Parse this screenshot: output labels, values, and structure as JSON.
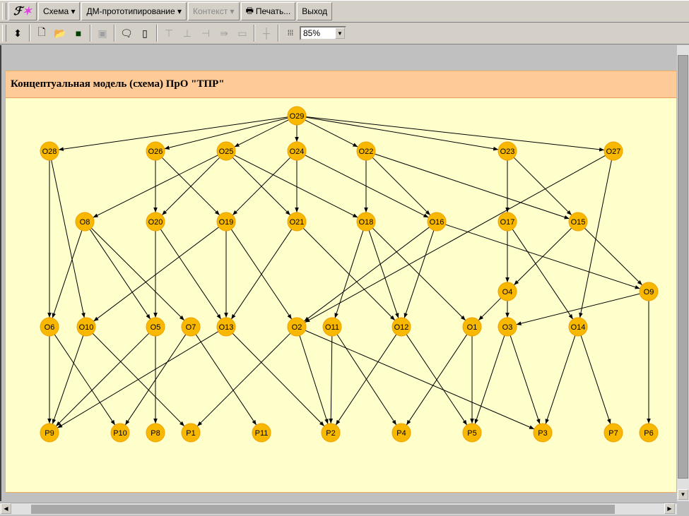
{
  "menubar": {
    "app_icon": "palette-icon",
    "schema": "Схема ▾",
    "prototyping": "ДМ-прототипирование ▾",
    "context": "Контекст ▾",
    "print": "Печать...",
    "print_icon": "printer-icon",
    "exit": "Выход"
  },
  "toolbar": {
    "zoom_value": "85%",
    "icons": [
      "move-updown-icon",
      "new-document-icon",
      "open-folder-icon",
      "save-icon",
      "clipboard-icon",
      "comment-icon",
      "scroll-icon",
      "align-top-icon",
      "align-bottom-icon",
      "align-left-icon",
      "align-right-icon",
      "frame-icon",
      "crosshair-icon",
      "grid-icon"
    ]
  },
  "panel": {
    "title": "Концептуальная модель (схема) ПрО  \"ТПР\""
  },
  "graph": {
    "colors": {
      "node_fill": "#f8b800",
      "node_stroke": "#f0a000",
      "edge": "#000000"
    },
    "nodes": [
      "O29",
      "O28",
      "O26",
      "O25",
      "O24",
      "O22",
      "O23",
      "O27",
      "O8",
      "O20",
      "O19",
      "O21",
      "O18",
      "O16",
      "O17",
      "O15",
      "O4",
      "O9",
      "O6",
      "O10",
      "O5",
      "O7",
      "O13",
      "O2",
      "O11",
      "O12",
      "O1",
      "O3",
      "O14",
      "P9",
      "P10",
      "P8",
      "P1",
      "P11",
      "P2",
      "P4",
      "P5",
      "P3",
      "P7",
      "P6"
    ],
    "edges": [
      [
        "O29",
        "O28"
      ],
      [
        "O29",
        "O26"
      ],
      [
        "O29",
        "O25"
      ],
      [
        "O29",
        "O24"
      ],
      [
        "O29",
        "O22"
      ],
      [
        "O29",
        "O23"
      ],
      [
        "O29",
        "O27"
      ],
      [
        "O28",
        "O6"
      ],
      [
        "O28",
        "O10"
      ],
      [
        "O26",
        "O20"
      ],
      [
        "O26",
        "O19"
      ],
      [
        "O25",
        "O8"
      ],
      [
        "O25",
        "O20"
      ],
      [
        "O25",
        "O21"
      ],
      [
        "O25",
        "O18"
      ],
      [
        "O24",
        "O19"
      ],
      [
        "O24",
        "O21"
      ],
      [
        "O24",
        "O16"
      ],
      [
        "O22",
        "O18"
      ],
      [
        "O22",
        "O16"
      ],
      [
        "O22",
        "O15"
      ],
      [
        "O23",
        "O17"
      ],
      [
        "O23",
        "O15"
      ],
      [
        "O27",
        "O2"
      ],
      [
        "O27",
        "O14"
      ],
      [
        "O8",
        "O6"
      ],
      [
        "O8",
        "O5"
      ],
      [
        "O8",
        "O7"
      ],
      [
        "O20",
        "O5"
      ],
      [
        "O20",
        "O13"
      ],
      [
        "O19",
        "O10"
      ],
      [
        "O19",
        "O13"
      ],
      [
        "O19",
        "O2"
      ],
      [
        "O21",
        "O13"
      ],
      [
        "O21",
        "O12"
      ],
      [
        "O18",
        "O11"
      ],
      [
        "O18",
        "O12"
      ],
      [
        "O18",
        "O1"
      ],
      [
        "O16",
        "O2"
      ],
      [
        "O16",
        "O12"
      ],
      [
        "O16",
        "O9"
      ],
      [
        "O17",
        "O4"
      ],
      [
        "O17",
        "O14"
      ],
      [
        "O15",
        "O4"
      ],
      [
        "O15",
        "O9"
      ],
      [
        "O4",
        "O1"
      ],
      [
        "O4",
        "O3"
      ],
      [
        "O9",
        "O3"
      ],
      [
        "O9",
        "P6"
      ],
      [
        "O6",
        "P9"
      ],
      [
        "O6",
        "P10"
      ],
      [
        "O10",
        "P9"
      ],
      [
        "O10",
        "P1"
      ],
      [
        "O5",
        "P9"
      ],
      [
        "O5",
        "P8"
      ],
      [
        "O7",
        "P10"
      ],
      [
        "O7",
        "P11"
      ],
      [
        "O13",
        "P9"
      ],
      [
        "O13",
        "P2"
      ],
      [
        "O2",
        "P1"
      ],
      [
        "O2",
        "P2"
      ],
      [
        "O2",
        "P3"
      ],
      [
        "O11",
        "P2"
      ],
      [
        "O11",
        "P4"
      ],
      [
        "O12",
        "P2"
      ],
      [
        "O12",
        "P5"
      ],
      [
        "O1",
        "P4"
      ],
      [
        "O1",
        "P5"
      ],
      [
        "O3",
        "P5"
      ],
      [
        "O3",
        "P3"
      ],
      [
        "O14",
        "P3"
      ],
      [
        "O14",
        "P7"
      ]
    ]
  }
}
